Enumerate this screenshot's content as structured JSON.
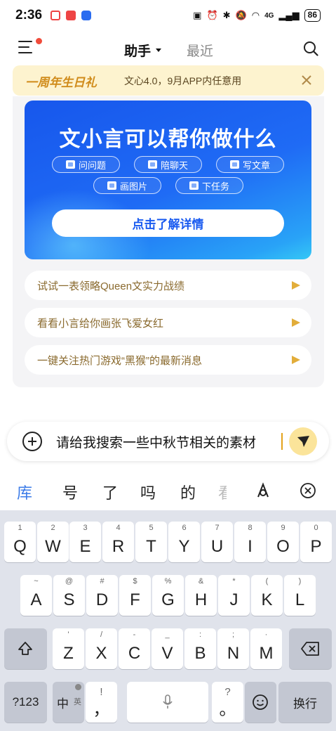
{
  "status_bar": {
    "time": "2:36",
    "battery": "86",
    "network": "4G"
  },
  "header": {
    "tab_assistant": "助手",
    "tab_recent": "最近"
  },
  "promo": {
    "title": "一周年生日礼",
    "text": "文心4.0，9月APP内任意用"
  },
  "hero": {
    "title": "文小言可以帮你做什么",
    "chips": [
      "问问题",
      "陪聊天",
      "写文章",
      "画图片",
      "下任务"
    ],
    "cta": "点击了解详情"
  },
  "suggestions": [
    "试试一表领略Queen文实力战绩",
    "看看小言给你画张飞爱女红",
    "一键关注热门游戏“黑猴”的最新消息"
  ],
  "input": {
    "value": "请给我搜索一些中秋节相关的素材"
  },
  "candidates": [
    "库",
    "号",
    "了",
    "吗",
    "的",
    "看"
  ],
  "keyboard": {
    "row1": [
      {
        "key": "Q",
        "sub": "1"
      },
      {
        "key": "W",
        "sub": "2"
      },
      {
        "key": "E",
        "sub": "3"
      },
      {
        "key": "R",
        "sub": "4"
      },
      {
        "key": "T",
        "sub": "5"
      },
      {
        "key": "Y",
        "sub": "6"
      },
      {
        "key": "U",
        "sub": "7"
      },
      {
        "key": "I",
        "sub": "8"
      },
      {
        "key": "O",
        "sub": "9"
      },
      {
        "key": "P",
        "sub": "0"
      }
    ],
    "row2": [
      {
        "key": "A",
        "sub": "~"
      },
      {
        "key": "S",
        "sub": "@"
      },
      {
        "key": "D",
        "sub": "#"
      },
      {
        "key": "F",
        "sub": "$"
      },
      {
        "key": "G",
        "sub": "%"
      },
      {
        "key": "H",
        "sub": "&"
      },
      {
        "key": "J",
        "sub": "*"
      },
      {
        "key": "K",
        "sub": "("
      },
      {
        "key": "L",
        "sub": ")"
      }
    ],
    "row3": [
      {
        "key": "Z",
        "sub": "'"
      },
      {
        "key": "X",
        "sub": "/"
      },
      {
        "key": "C",
        "sub": "-"
      },
      {
        "key": "V",
        "sub": "_"
      },
      {
        "key": "B",
        "sub": ":"
      },
      {
        "key": "N",
        "sub": ";"
      },
      {
        "key": "M",
        "sub": "·"
      }
    ],
    "numbers_label": "?123",
    "lang_label": "中",
    "lang_sub": "英",
    "comma_key": "，",
    "comma_sub": "!",
    "period_key": "。",
    "period_sub": "?",
    "enter_label": "换行"
  }
}
